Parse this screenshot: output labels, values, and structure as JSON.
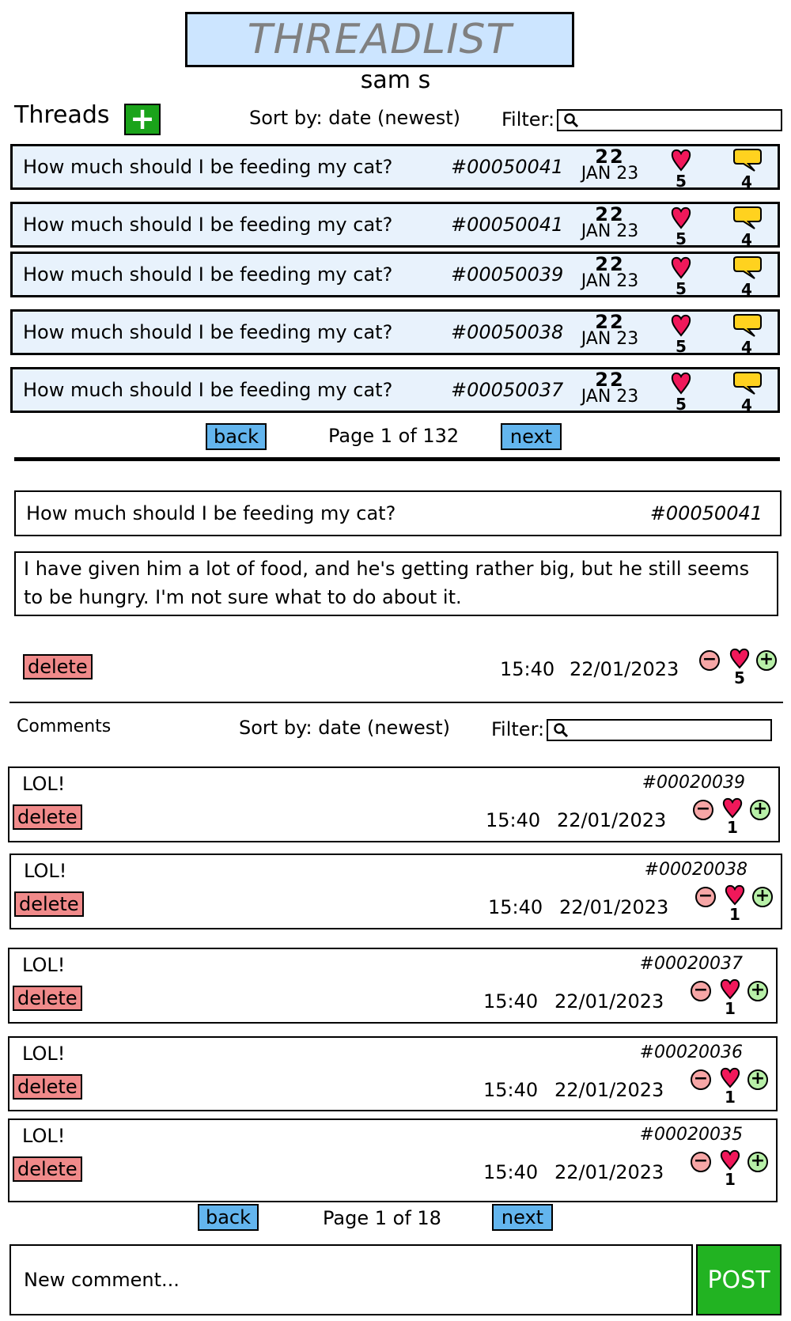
{
  "header": {
    "app_title": "THREADLIST",
    "username": "sam s"
  },
  "threads_toolbar": {
    "label": "Threads",
    "add_glyph": "+",
    "sort_label": "Sort by: date (newest)",
    "filter_label": "Filter:",
    "filter_value": ""
  },
  "threads": [
    {
      "title": "How much should I be feeding my cat?",
      "id": "#00050041",
      "day": "22",
      "month": "JAN 23",
      "likes": "5",
      "comments": "4"
    },
    {
      "title": "How much should I be feeding my cat?",
      "id": "#00050041",
      "day": "22",
      "month": "JAN 23",
      "likes": "5",
      "comments": "4"
    },
    {
      "title": "How much should I be feeding my cat?",
      "id": "#00050039",
      "day": "22",
      "month": "JAN 23",
      "likes": "5",
      "comments": "4"
    },
    {
      "title": "How much should I be feeding my cat?",
      "id": "#00050038",
      "day": "22",
      "month": "JAN 23",
      "likes": "5",
      "comments": "4"
    },
    {
      "title": "How much should I be feeding my cat?",
      "id": "#00050037",
      "day": "22",
      "month": "JAN 23",
      "likes": "5",
      "comments": "4"
    }
  ],
  "threads_pager": {
    "back_label": "back",
    "page_text": "Page 1 of 132",
    "next_label": "next"
  },
  "thread_detail": {
    "title": "How much should I be feeding my cat?",
    "id": "#00050041",
    "body_line1": "I have given him a lot of food, and he's getting rather big, but he still seems",
    "body_line2": "to be hungry. I'm not sure what to do about it.",
    "delete_label": "delete",
    "time": "15:40",
    "date": "22/01/2023",
    "likes": "5"
  },
  "comments_toolbar": {
    "label": "Comments",
    "sort_label": "Sort by: date (newest)",
    "filter_label": "Filter:",
    "filter_value": ""
  },
  "comments": [
    {
      "text": "LOL!",
      "id": "#00020039",
      "delete_label": "delete",
      "time": "15:40",
      "date": "22/01/2023",
      "likes": "1"
    },
    {
      "text": "LOL!",
      "id": "#00020038",
      "delete_label": "delete",
      "time": "15:40",
      "date": "22/01/2023",
      "likes": "1"
    },
    {
      "text": "LOL!",
      "id": "#00020037",
      "delete_label": "delete",
      "time": "15:40",
      "date": "22/01/2023",
      "likes": "1"
    },
    {
      "text": "LOL!",
      "id": "#00020036",
      "delete_label": "delete",
      "time": "15:40",
      "date": "22/01/2023",
      "likes": "1"
    },
    {
      "text": "LOL!",
      "id": "#00020035",
      "delete_label": "delete",
      "time": "15:40",
      "date": "22/01/2023",
      "likes": "1"
    }
  ],
  "comments_pager": {
    "back_label": "back",
    "page_text": "Page 1 of 18",
    "next_label": "next"
  },
  "composer": {
    "placeholder": "New comment...",
    "post_label": "POST"
  },
  "vote_glyphs": {
    "minus": "−",
    "plus": "+"
  },
  "colors": {
    "title_bg": "#cce5ff",
    "row_bg": "#e8f2fc",
    "add_button": "#1aa31a",
    "pager_button": "#63b5ee",
    "delete_button": "#f08a8a",
    "heart": "#f0185a",
    "bubble": "#ffd21f",
    "post_button": "#22b322"
  },
  "icons": {
    "add": "plus-icon",
    "search": "search-icon",
    "like": "heart-icon",
    "comment": "speech-bubble-icon",
    "downvote": "minus-circle-icon",
    "upvote": "plus-circle-icon"
  }
}
